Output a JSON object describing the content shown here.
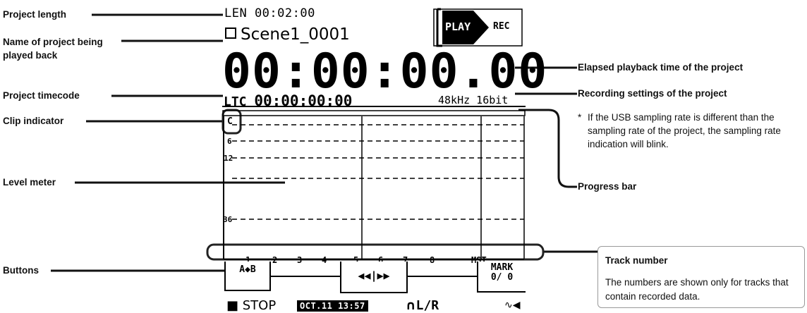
{
  "screen": {
    "project_length": "LEN 00:02:00",
    "project_name": "Scene1_0001",
    "elapsed_time": "00:00:00.00",
    "ltc_label": "LTC",
    "ltc_value": "00:00:00:00",
    "recording_settings": "48kHz 16bit",
    "play_label": "PLAY",
    "rec_label": "REC",
    "clip_indicator": "C",
    "meter_scale": [
      "6",
      "12",
      "36"
    ],
    "track_numbers": [
      "1",
      "2",
      "3",
      "4",
      "5",
      "6",
      "7",
      "8",
      "MST"
    ],
    "buttons": {
      "ab": "A◆B",
      "transport": "◀◀|▶▶",
      "mark_label": "MARK",
      "mark_count": "0/ 0"
    },
    "status": "■ STOP",
    "date": "OCT.11  13:57",
    "monitor": "L/R"
  },
  "callouts": {
    "project_length": "Project length",
    "project_name": "Name of project being played back",
    "project_timecode": "Project timecode",
    "clip_indicator": "Clip indicator",
    "level_meter": "Level meter",
    "buttons": "Buttons",
    "elapsed_time": "Elapsed playback time of the project",
    "recording_settings": "Recording settings of the project",
    "usb_note": "If the USB sampling rate is different than the sampling rate of the project, the sampling rate indication will blink.",
    "usb_note_marker": "*",
    "progress_bar": "Progress bar",
    "track_number_title": "Track number",
    "track_number_text": "The numbers are shown only for tracks that contain recorded data."
  }
}
